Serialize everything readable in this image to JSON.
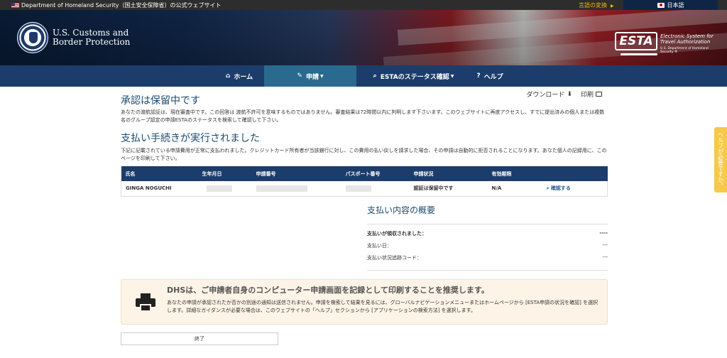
{
  "topbar": {
    "site_label": "Department of Homeland Security（国土安全保障省）の公式ウェブサイト",
    "language_change": "言語の変換",
    "language_selected": "日本語"
  },
  "header": {
    "agency_line1": "U.S. Customs and",
    "agency_line2": "Border Protection",
    "esta_logo": "ESTA",
    "esta_line1": "Electronic System for",
    "esta_line2": "Travel Authorization",
    "esta_sub": "U.S. Department of Homeland Security ®"
  },
  "nav": {
    "home": "ホーム",
    "apply": "申請",
    "status": "ESTAのステータス確認",
    "help": "ヘルプ"
  },
  "tools": {
    "download": "ダウンロード",
    "print": "印刷"
  },
  "pending": {
    "title": "承認は保留中です",
    "body": "あなたの渡航認証は、現在審査中です。この回答は 渡航不許可を意味するものではありません。審査結果は72時間以内に判明します下さいます。このウェブサイトに再度アクセスし、すでに提出済みの個人または複数名のグループ認定の申請ESTAのステータスを検索して確認して下さい。"
  },
  "payment": {
    "title": "支払い手続きが実行されました",
    "body": "下記に記載されている申請費用が正常に支払われました。クレジットカード所有者が当該銀行に対し、この費用の払い戻しを請求した場合、その申請は自動的に拒否されることになります。あなた個人の記録用に、このページを印刷して下さい。"
  },
  "table": {
    "headers": [
      "氏名",
      "生年月日",
      "申請番号",
      "パスポート番号",
      "申請状況",
      "有効期限",
      ""
    ],
    "row": {
      "name": "GINGA NOGUCHI",
      "status": "認証は保留中です",
      "expiry": "N/A",
      "action": "確認する"
    }
  },
  "summary": {
    "title": "支払い内容の概要",
    "received_label": "支払いが領収されました：",
    "received_value": "----",
    "date_label": "支払い日：",
    "date_value": "---",
    "tracking_label": "支払い状況追跡コード：",
    "tracking_value": "---"
  },
  "notice": {
    "title": "DHSは、ご申請者自身のコンピューター申請画面を記録として印刷することを推奨します。",
    "body": "あなたの申請が承認されたか否かの別途の通知は送信されません。申請を検索して結果を見るには、グローバルナビゲーションメニューまたはホームページから [ESTA申請の状況を確認] を選択します。詳細なガイダンスが必要な場合は、このウェブサイトの「ヘルプ」セクションから [アプリケーションの検索方法] を選択します。"
  },
  "end_button": "終了",
  "side_tab": "ヘルプが必要ですか。"
}
